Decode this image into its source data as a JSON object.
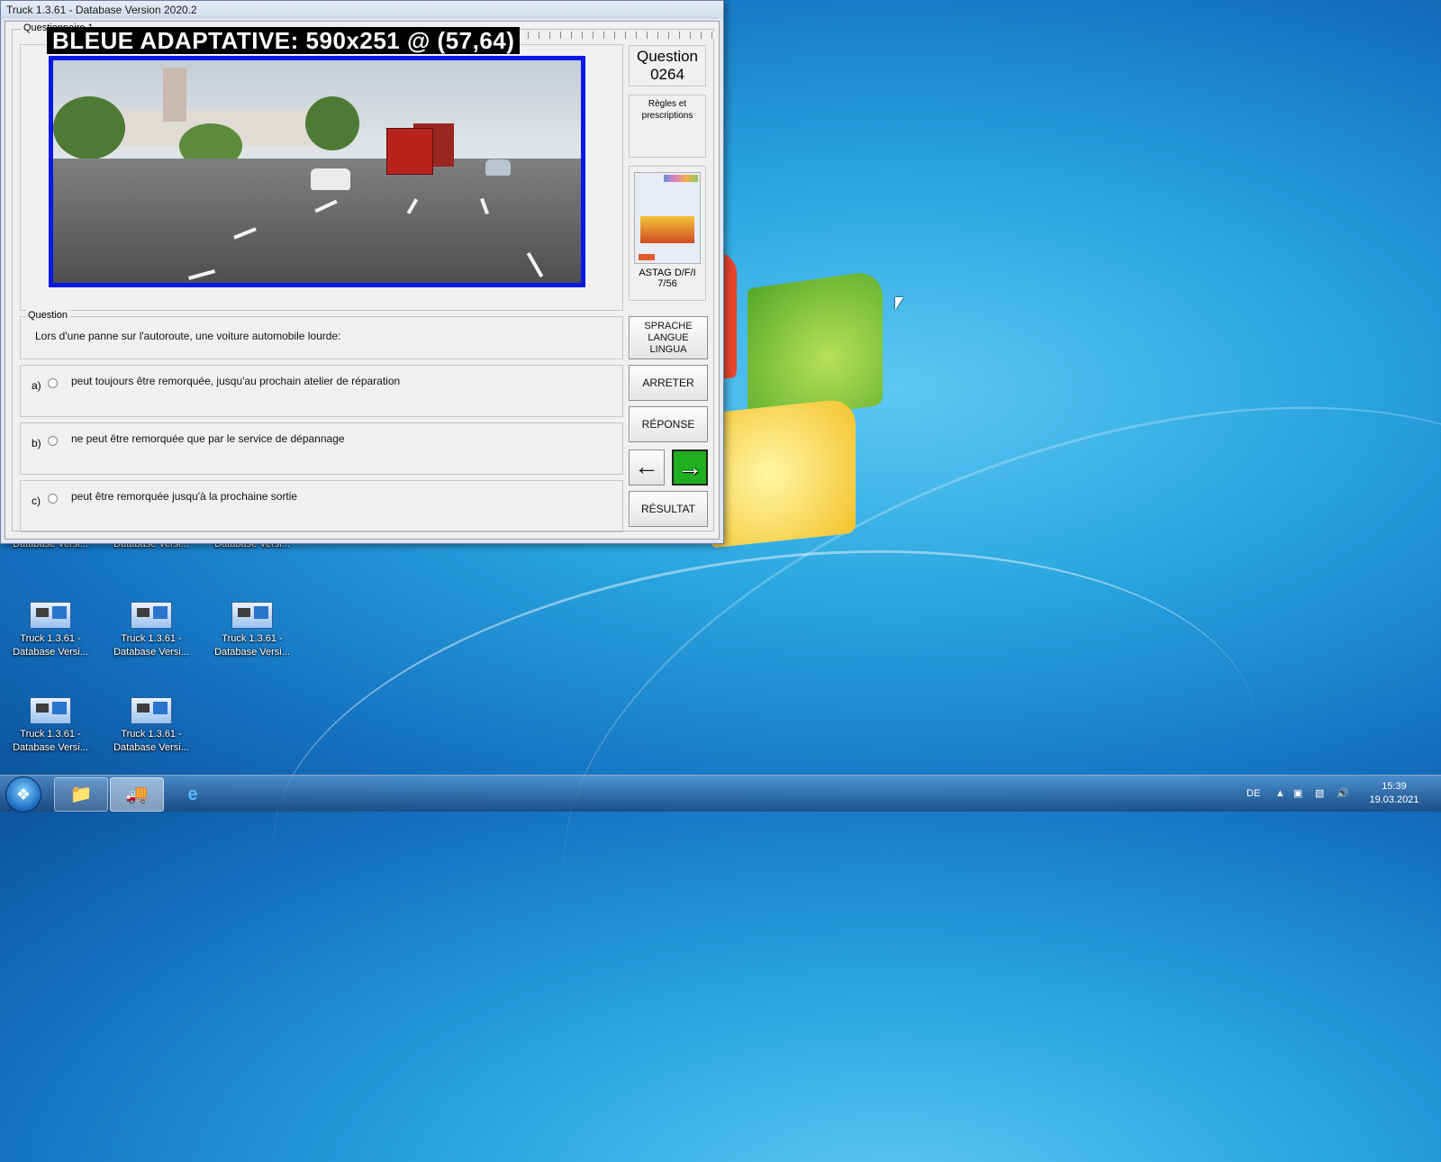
{
  "window": {
    "title": "Truck 1.3.61 - Database Version 2020.2"
  },
  "questionnaire": {
    "group_label": "Questionnaire 1",
    "overlay_label": "BLEUE ADAPTATIVE: 590x251 @ (57,64)",
    "question_number_label": "Question",
    "question_number": "0264",
    "category": "Règles et prescriptions",
    "book": {
      "name": "ASTAG D/F/I",
      "pages": "7/56"
    },
    "question_legend": "Question",
    "question_text": "Lors d'une panne sur l'autoroute, une voiture automobile lourde:",
    "answers": [
      {
        "letter": "a)",
        "text": "peut toujours être remorquée, jusqu'au prochain atelier de réparation",
        "selected": false
      },
      {
        "letter": "b)",
        "text": "ne peut être remorquée que par le service de dépannage",
        "selected": false
      },
      {
        "letter": "c)",
        "text": "peut être remorquée jusqu'à la prochaine sortie",
        "selected": false
      }
    ],
    "buttons": {
      "language_1": "SPRACHE",
      "language_2": "LANGUE",
      "language_3": "LINGUA",
      "stop": "ARRETER",
      "answer": "RÉPONSE",
      "result": "RÉSULTAT"
    },
    "colors": {
      "image_border": "#0a18e6",
      "next_arrow": "#1fae1f"
    }
  },
  "desktop": {
    "icons": [
      {
        "line1": "",
        "line2": "Database Versi..."
      },
      {
        "line1": "",
        "line2": "Database Versi..."
      },
      {
        "line1": "",
        "line2": "Database Versi..."
      },
      {
        "line1": "Truck 1.3.61 -",
        "line2": "Database Versi..."
      },
      {
        "line1": "Truck 1.3.61 -",
        "line2": "Database Versi..."
      },
      {
        "line1": "Truck 1.3.61 -",
        "line2": "Database Versi..."
      },
      {
        "line1": "Truck 1.3.61 -",
        "line2": "Database Versi..."
      },
      {
        "line1": "Truck 1.3.61 -",
        "line2": "Database Versi..."
      }
    ]
  },
  "taskbar": {
    "language": "DE",
    "time": "15:39",
    "date": "19.03.2021",
    "pinned": [
      "file-explorer-icon",
      "truck-app-icon",
      "internet-explorer-icon"
    ]
  }
}
